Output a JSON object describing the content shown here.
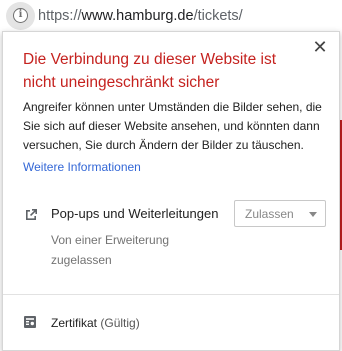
{
  "addressbar": {
    "info_icon": "info-icon",
    "url_scheme": "https://",
    "url_host": "www.hamburg.de",
    "url_path": "/tickets/"
  },
  "popup": {
    "close_symbol": "✕",
    "title": "Die Verbindung zu dieser Website ist nicht uneingeschränkt sicher",
    "description": "Angreifer können unter Umständen die Bilder sehen, die Sie sich auf dieser Website ansehen, und könnten dann versuchen, Sie durch Ändern der Bilder zu täuschen.",
    "more_info_link": "Weitere Informationen",
    "permission": {
      "icon": "open-in-new-icon",
      "label": "Pop-ups und Weiterleitungen",
      "selected_value": "Zulassen",
      "sublabel": "Von einer Erweiterung zugelassen"
    },
    "certificate": {
      "icon": "certificate-icon",
      "label": "Zertifikat",
      "status": "(Gültig)"
    }
  },
  "colors": {
    "title_red": "#c5221f",
    "link_blue": "#3367d6"
  }
}
